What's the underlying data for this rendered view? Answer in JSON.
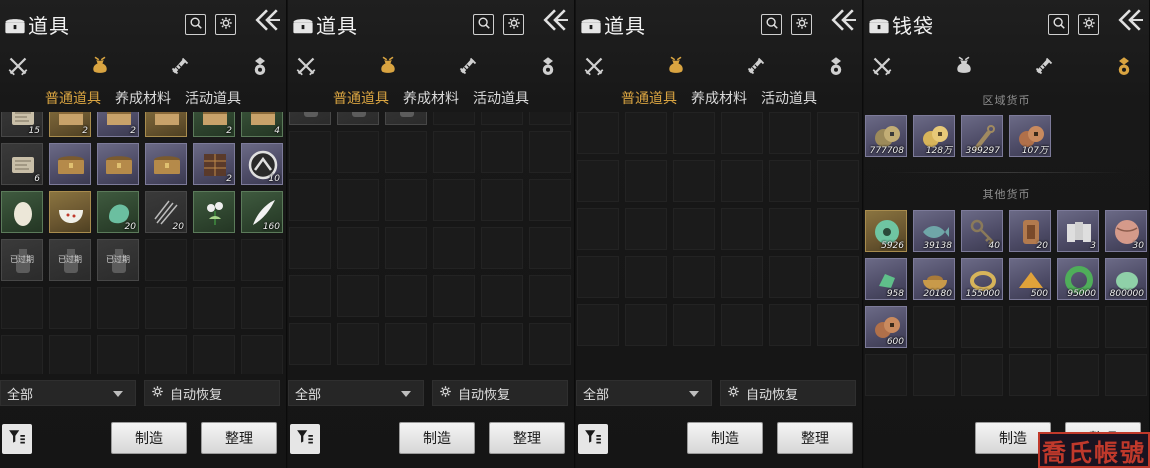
{
  "colors": {
    "accent": "#d9a441",
    "watermark": "#c0392b"
  },
  "watermark": {
    "text": "喬氏帳號"
  },
  "icons": {
    "title": "chest-icon",
    "search": "search-icon",
    "settings": "gear-icon",
    "back": "double-chevron-left-icon",
    "cat0": "crossed-swords-icon",
    "cat1": "pouch-icon",
    "cat2": "scroll-icon",
    "cat3": "coin-purse-icon",
    "filter": "sort-filter-icon",
    "auto": "gear-icon"
  },
  "panels": [
    {
      "title": "道具",
      "active_category": 1,
      "subtabs": [
        {
          "label": "普通道具",
          "active": true
        },
        {
          "label": "养成材料",
          "active": false
        },
        {
          "label": "活动道具",
          "active": false
        }
      ],
      "filter": {
        "label": "全部"
      },
      "auto_restore": {
        "label": "自动恢复"
      },
      "buttons": {
        "make": "制造",
        "tidy": "整理"
      },
      "scroll_offset_rows": 0.35,
      "items": [
        {
          "q": "grey",
          "count": "15",
          "art": "scroll"
        },
        {
          "q": "gold",
          "count": "2",
          "art": "box"
        },
        {
          "q": "purple",
          "count": "2",
          "art": "box"
        },
        {
          "q": "gold",
          "count": "",
          "art": "box"
        },
        {
          "q": "green",
          "count": "2",
          "art": "box"
        },
        {
          "q": "green",
          "count": "4",
          "art": "box"
        },
        {
          "q": "grey",
          "count": "6",
          "art": "scroll"
        },
        {
          "q": "purple",
          "count": "",
          "art": "chest"
        },
        {
          "q": "purple",
          "count": "",
          "art": "chest"
        },
        {
          "q": "purple",
          "count": "",
          "art": "chest"
        },
        {
          "q": "purple",
          "count": "2",
          "art": "cabinet"
        },
        {
          "q": "purple",
          "count": "10",
          "art": "badge"
        },
        {
          "q": "green",
          "count": "",
          "art": "egg"
        },
        {
          "q": "gold",
          "count": "",
          "art": "bowl"
        },
        {
          "q": "green",
          "count": "20",
          "art": "jade"
        },
        {
          "q": "grey",
          "count": "20",
          "art": "needles"
        },
        {
          "q": "green",
          "count": "",
          "art": "flower"
        },
        {
          "q": "green",
          "count": "160",
          "art": "ink"
        },
        {
          "q": "grey",
          "count": "",
          "expired": "已过期",
          "art": "bottle"
        },
        {
          "q": "grey",
          "count": "",
          "expired": "已过期",
          "art": "bottle"
        },
        {
          "q": "grey",
          "count": "",
          "expired": "已过期",
          "art": "bottle"
        },
        {
          "q": "empty"
        },
        {
          "q": "empty"
        },
        {
          "q": "empty"
        },
        {
          "q": "empty"
        },
        {
          "q": "empty"
        },
        {
          "q": "empty"
        },
        {
          "q": "empty"
        },
        {
          "q": "empty"
        },
        {
          "q": "empty"
        },
        {
          "q": "empty"
        },
        {
          "q": "empty"
        },
        {
          "q": "empty"
        },
        {
          "q": "empty"
        },
        {
          "q": "empty"
        },
        {
          "q": "empty"
        }
      ]
    },
    {
      "title": "道具",
      "active_category": 1,
      "subtabs": [
        {
          "label": "普通道具",
          "active": true
        },
        {
          "label": "养成材料",
          "active": false
        },
        {
          "label": "活动道具",
          "active": false
        }
      ],
      "filter": {
        "label": "全部"
      },
      "auto_restore": {
        "label": "自动恢复"
      },
      "buttons": {
        "make": "制造",
        "tidy": "整理"
      },
      "scroll_offset_rows": 0.6,
      "items": [
        {
          "q": "grey",
          "count": "",
          "expired": "已过期",
          "art": "bottle"
        },
        {
          "q": "grey",
          "count": "",
          "expired": "已过期",
          "art": "bottle"
        },
        {
          "q": "grey",
          "count": "",
          "expired": "已过期",
          "art": "bottle"
        },
        {
          "q": "empty"
        },
        {
          "q": "empty"
        },
        {
          "q": "empty"
        },
        {
          "q": "empty"
        },
        {
          "q": "empty"
        },
        {
          "q": "empty"
        },
        {
          "q": "empty"
        },
        {
          "q": "empty"
        },
        {
          "q": "empty"
        },
        {
          "q": "empty"
        },
        {
          "q": "empty"
        },
        {
          "q": "empty"
        },
        {
          "q": "empty"
        },
        {
          "q": "empty"
        },
        {
          "q": "empty"
        },
        {
          "q": "empty"
        },
        {
          "q": "empty"
        },
        {
          "q": "empty"
        },
        {
          "q": "empty"
        },
        {
          "q": "empty"
        },
        {
          "q": "empty"
        },
        {
          "q": "empty"
        },
        {
          "q": "empty"
        },
        {
          "q": "empty"
        },
        {
          "q": "empty"
        },
        {
          "q": "empty"
        },
        {
          "q": "empty"
        },
        {
          "q": "empty"
        },
        {
          "q": "empty"
        },
        {
          "q": "empty"
        },
        {
          "q": "empty"
        },
        {
          "q": "empty"
        },
        {
          "q": "empty"
        }
      ]
    },
    {
      "title": "道具",
      "active_category": 1,
      "subtabs": [
        {
          "label": "普通道具",
          "active": true
        },
        {
          "label": "养成材料",
          "active": false
        },
        {
          "label": "活动道具",
          "active": false
        }
      ],
      "filter": {
        "label": "全部"
      },
      "auto_restore": {
        "label": "自动恢复"
      },
      "buttons": {
        "make": "制造",
        "tidy": "整理"
      },
      "scroll_offset_rows": 0,
      "items": [
        {
          "q": "empty"
        },
        {
          "q": "empty"
        },
        {
          "q": "empty"
        },
        {
          "q": "empty"
        },
        {
          "q": "empty"
        },
        {
          "q": "empty"
        },
        {
          "q": "empty"
        },
        {
          "q": "empty"
        },
        {
          "q": "empty"
        },
        {
          "q": "empty"
        },
        {
          "q": "empty"
        },
        {
          "q": "empty"
        },
        {
          "q": "empty"
        },
        {
          "q": "empty"
        },
        {
          "q": "empty"
        },
        {
          "q": "empty"
        },
        {
          "q": "empty"
        },
        {
          "q": "empty"
        },
        {
          "q": "empty"
        },
        {
          "q": "empty"
        },
        {
          "q": "empty"
        },
        {
          "q": "empty"
        },
        {
          "q": "empty"
        },
        {
          "q": "empty"
        },
        {
          "q": "empty"
        },
        {
          "q": "empty"
        },
        {
          "q": "empty"
        },
        {
          "q": "empty"
        },
        {
          "q": "empty"
        },
        {
          "q": "empty"
        }
      ]
    },
    {
      "title": "钱袋",
      "active_category": 3,
      "section_regional": "区域货币",
      "section_other": "其他货币",
      "buttons": {
        "make": "制造",
        "tidy": "整理"
      },
      "regional_items": [
        {
          "q": "purple",
          "count": "777708",
          "art": "coins"
        },
        {
          "q": "purple",
          "count": "128万",
          "art": "gold-coins"
        },
        {
          "q": "purple",
          "count": "399297",
          "art": "knife"
        },
        {
          "q": "purple",
          "count": "107万",
          "art": "copper-coins"
        }
      ],
      "other_items": [
        {
          "q": "gold",
          "count": "5926",
          "art": "jade-disc"
        },
        {
          "q": "purple",
          "count": "39138",
          "art": "fish"
        },
        {
          "q": "purple",
          "count": "40",
          "art": "key"
        },
        {
          "q": "purple",
          "count": "20",
          "art": "token"
        },
        {
          "q": "purple",
          "count": "3",
          "art": "tickets"
        },
        {
          "q": "purple",
          "count": "30",
          "art": "ball"
        },
        {
          "q": "purple",
          "count": "958",
          "art": "jade-bit"
        },
        {
          "q": "purple",
          "count": "20180",
          "art": "bowl-gold"
        },
        {
          "q": "purple",
          "count": "155000",
          "art": "ring"
        },
        {
          "q": "purple",
          "count": "500",
          "art": "spikes"
        },
        {
          "q": "purple",
          "count": "95000",
          "art": "jade-ring"
        },
        {
          "q": "purple",
          "count": "800000",
          "art": "jade-stone"
        },
        {
          "q": "purple",
          "count": "600",
          "art": "copper-coins"
        },
        {
          "q": "empty"
        },
        {
          "q": "empty"
        },
        {
          "q": "empty"
        },
        {
          "q": "empty"
        },
        {
          "q": "empty"
        },
        {
          "q": "empty"
        },
        {
          "q": "empty"
        },
        {
          "q": "empty"
        },
        {
          "q": "empty"
        },
        {
          "q": "empty"
        },
        {
          "q": "empty"
        }
      ]
    }
  ]
}
